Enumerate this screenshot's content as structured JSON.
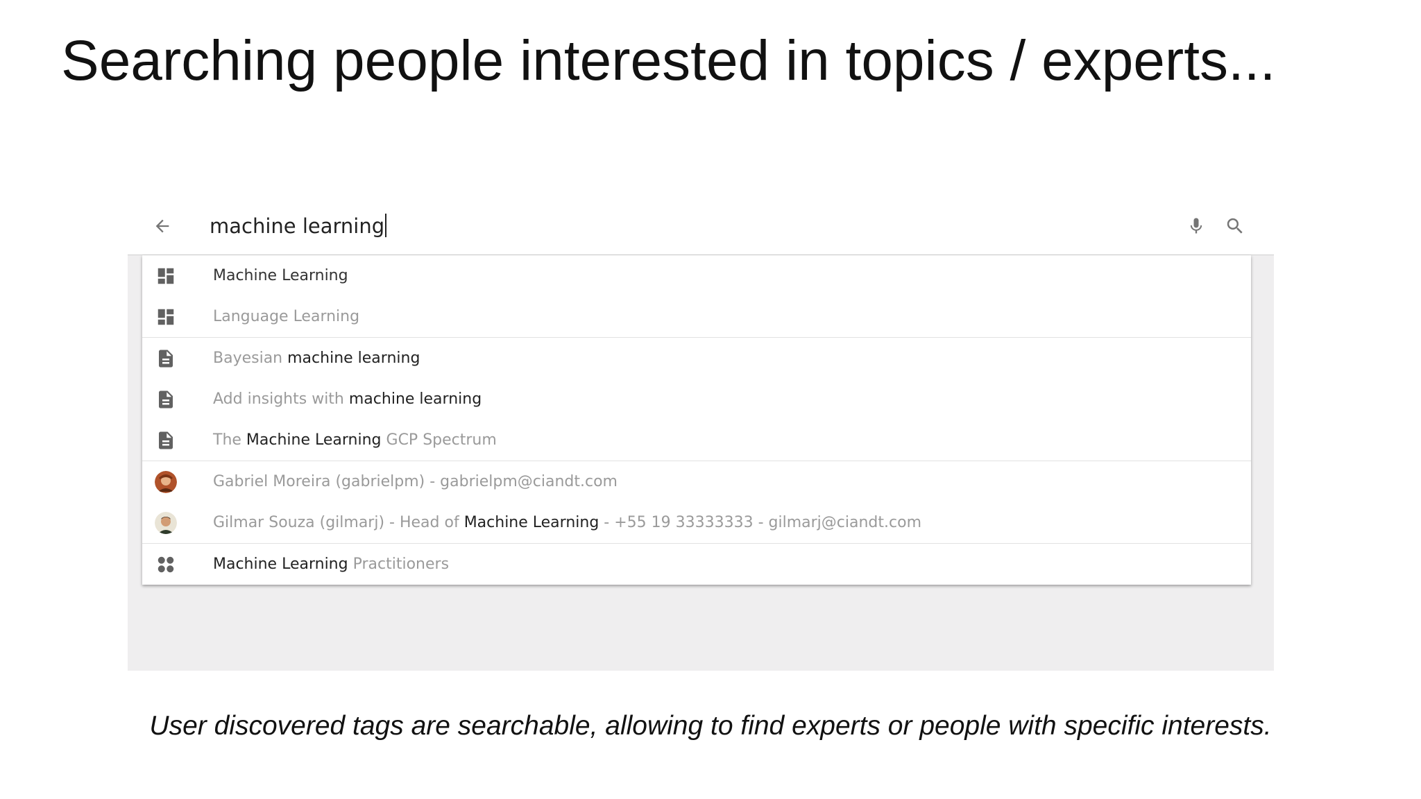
{
  "slide": {
    "title": "Searching people interested in topics / experts...",
    "caption": "User discovered tags are searchable, allowing to find experts or people with specific interests."
  },
  "search": {
    "query": "machine learning",
    "back_icon": "arrow-back-icon",
    "mic_icon": "microphone-icon",
    "search_icon": "search-icon"
  },
  "suggestions": {
    "topics": [
      {
        "icon": "dashboard-icon",
        "text": "Machine Learning"
      },
      {
        "icon": "dashboard-icon",
        "text": "Language Learning"
      }
    ],
    "documents": [
      {
        "icon": "document-icon",
        "pre": "Bayesian ",
        "hl": "machine learning",
        "post": ""
      },
      {
        "icon": "document-icon",
        "pre": "Add insights with ",
        "hl": "machine learning",
        "post": ""
      },
      {
        "icon": "document-icon",
        "pre": "The ",
        "hl": "Machine Learning",
        "post": " GCP Spectrum"
      }
    ],
    "people": [
      {
        "icon": "avatar",
        "pre": "Gabriel Moreira (gabrielpm) - gabrielpm@ciandt.com",
        "hl": "",
        "post": ""
      },
      {
        "icon": "avatar",
        "pre": "Gilmar Souza (gilmarj) - Head of ",
        "hl": "Machine Learning",
        "post": " - +55 19 33333333 - gilmarj@ciandt.com"
      }
    ],
    "communities": [
      {
        "icon": "community-icon",
        "pre": "",
        "hl": "Machine Learning",
        "post": " Practitioners"
      }
    ]
  },
  "colors": {
    "icon_gray": "#616161",
    "text_muted": "#9a9a9a",
    "text_dark": "#222222",
    "backdrop": "#efeeef"
  }
}
